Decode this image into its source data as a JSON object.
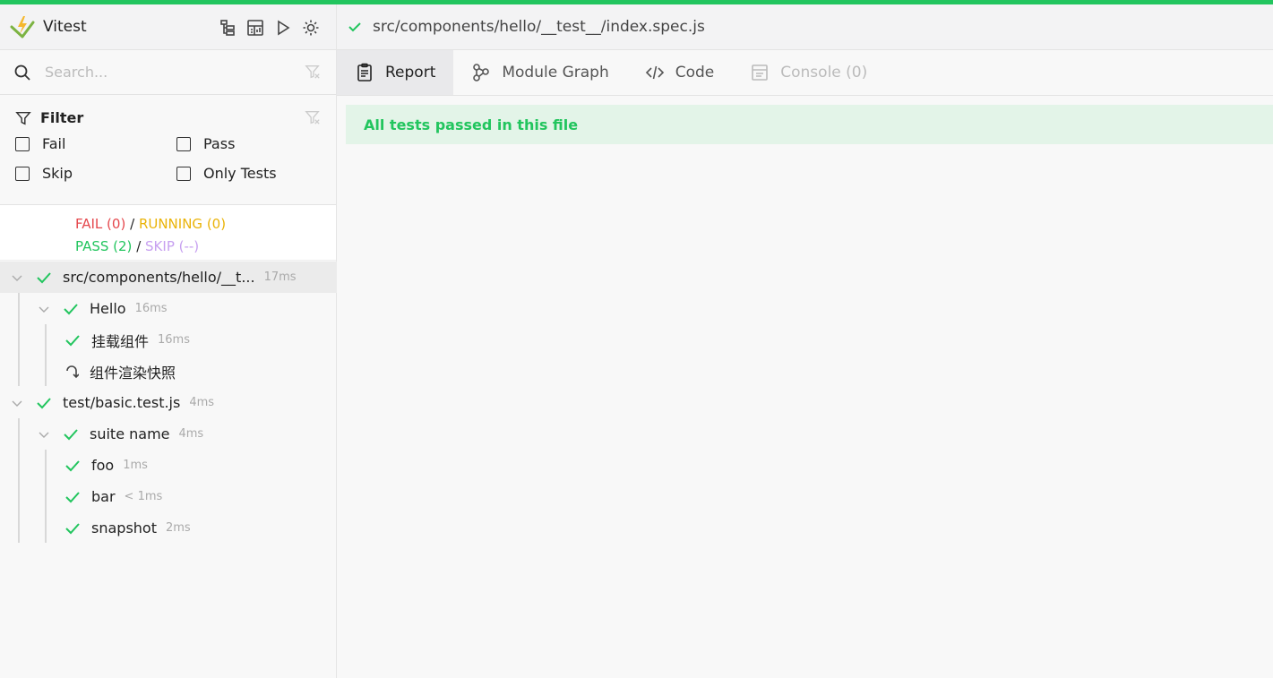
{
  "app": {
    "name": "Vitest"
  },
  "colors": {
    "accent": "#22c55e",
    "fail": "#e5484d",
    "running": "#eab308",
    "skip": "#c7a0f0"
  },
  "search": {
    "placeholder": "Search..."
  },
  "filter": {
    "title": "Filter",
    "options": [
      {
        "label": "Fail",
        "checked": false
      },
      {
        "label": "Pass",
        "checked": false
      },
      {
        "label": "Skip",
        "checked": false
      },
      {
        "label": "Only Tests",
        "checked": false
      }
    ]
  },
  "summary": {
    "fail": "FAIL (0)",
    "running": "RUNNING (0)",
    "pass": "PASS (2)",
    "skip": "SKIP (--)",
    "separator": "/"
  },
  "tree": [
    {
      "label": "src/components/hello/__t...",
      "duration": "17ms",
      "level": 0,
      "status": "pass",
      "expanded": true
    },
    {
      "label": "Hello",
      "duration": "16ms",
      "level": 1,
      "status": "pass",
      "expanded": true
    },
    {
      "label": "挂载组件",
      "duration": "16ms",
      "level": 2,
      "status": "pass"
    },
    {
      "label": "组件渲染快照",
      "duration": "",
      "level": 2,
      "status": "skip"
    },
    {
      "label": "test/basic.test.js",
      "duration": "4ms",
      "level": 0,
      "status": "pass",
      "expanded": true
    },
    {
      "label": "suite name",
      "duration": "4ms",
      "level": 1,
      "status": "pass",
      "expanded": true
    },
    {
      "label": "foo",
      "duration": "1ms",
      "level": 2,
      "status": "pass"
    },
    {
      "label": "bar",
      "duration": "< 1ms",
      "level": 2,
      "status": "pass"
    },
    {
      "label": "snapshot",
      "duration": "2ms",
      "level": 2,
      "status": "pass"
    }
  ],
  "breadcrumb": {
    "path": "src/components/hello/__test__/index.spec.js"
  },
  "tabs": [
    {
      "label": "Report",
      "icon": "clipboard-icon",
      "active": true
    },
    {
      "label": "Module Graph",
      "icon": "graph-icon",
      "active": false
    },
    {
      "label": "Code",
      "icon": "code-icon",
      "active": false
    },
    {
      "label": "Console (0)",
      "icon": "console-icon",
      "active": false,
      "disabled": true
    }
  ],
  "report": {
    "message": "All tests passed in this file"
  }
}
